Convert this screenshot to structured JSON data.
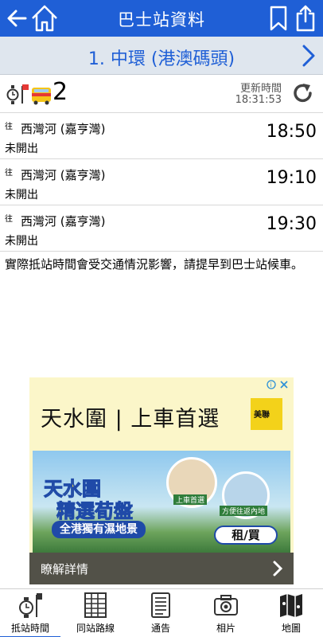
{
  "header": {
    "title": "巴士站資料"
  },
  "stop": {
    "name": "1. 中環 (港澳碼頭)"
  },
  "route": {
    "number": "2",
    "updated_label": "更新時間",
    "updated_time": "18:31:53"
  },
  "etas": [
    {
      "to": "往",
      "destination": "西灣河 (嘉亨灣)",
      "status": "未開出",
      "time": "18:50"
    },
    {
      "to": "往",
      "destination": "西灣河 (嘉亨灣)",
      "status": "未開出",
      "time": "19:10"
    },
    {
      "to": "往",
      "destination": "西灣河 (嘉亨灣)",
      "status": "未開出",
      "time": "19:30"
    }
  ],
  "notice": "實際抵站時間會受交通情況影響，請提早到巴士站候車。",
  "ad": {
    "headline": "天水圍 | 上車首選",
    "banner_title_1": "天水圍",
    "banner_title_2": "精選荀盤",
    "banner_subtitle": "全港獨有濕地景",
    "circle_tag_1": "上車首選",
    "circle_tag_2": "方便往返內地",
    "rent_buy": "租/買",
    "more": "瞭解詳情",
    "logo_text": "美聯"
  },
  "tabs": [
    {
      "label": "抵站時間",
      "icon": "clock-bus-stop-icon"
    },
    {
      "label": "同站路線",
      "icon": "route-list-icon"
    },
    {
      "label": "通告",
      "icon": "notice-document-icon"
    },
    {
      "label": "相片",
      "icon": "camera-icon"
    },
    {
      "label": "地圖",
      "icon": "map-icon"
    }
  ],
  "colors": {
    "primary": "#1f5fd6",
    "stop_bar": "#dfe6ee"
  }
}
